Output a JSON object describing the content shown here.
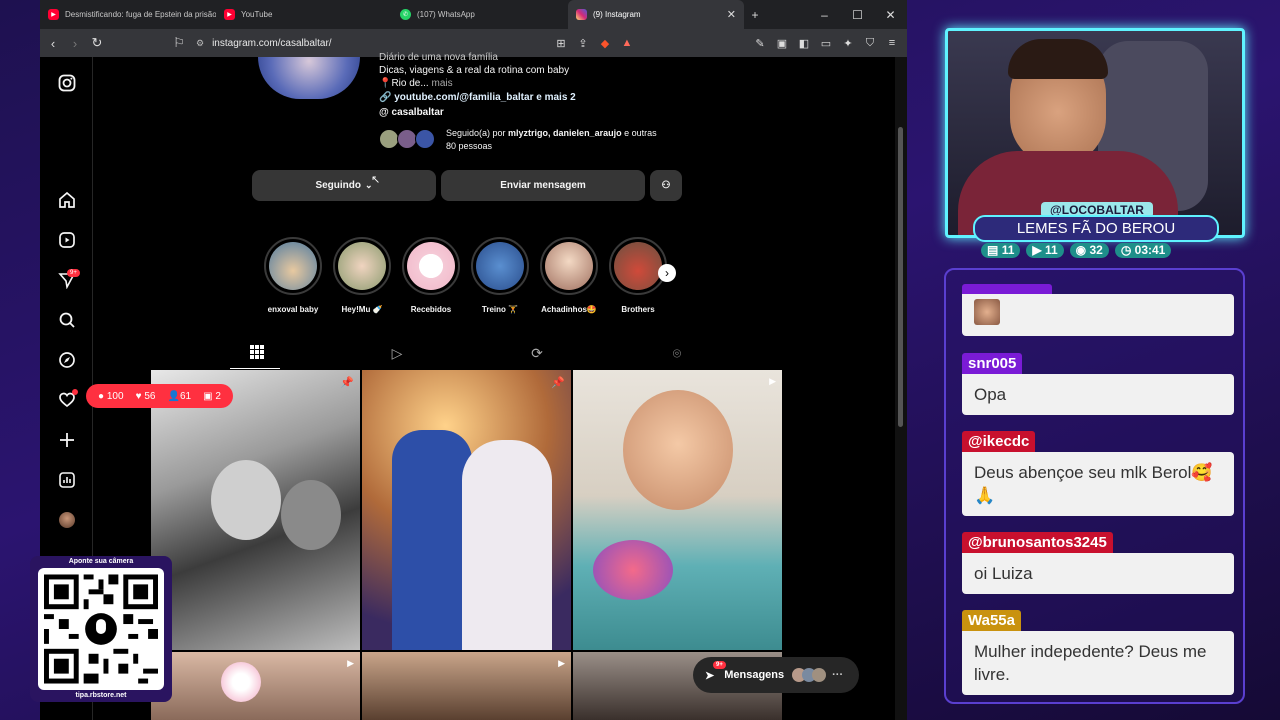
{
  "browser": {
    "tabs": [
      {
        "title": "Desmistificando: fuga de Epstein da prisão e",
        "icon": "youtube-icon",
        "color": "#ff0033"
      },
      {
        "title": "YouTube",
        "icon": "youtube-icon",
        "color": "#ff0033"
      },
      {
        "title": "(107) WhatsApp",
        "icon": "whatsapp-icon",
        "color": "#25d366"
      },
      {
        "title": "(9) Instagram",
        "icon": "instagram-icon",
        "color": "#e1306c"
      }
    ],
    "url": "instagram.com/casalbaltar/"
  },
  "sidebar": {
    "notifications_badge": "9+"
  },
  "profile": {
    "bio_line1": "Diário de uma nova família",
    "bio_line2": "Dicas, viagens & a real da rotina com baby",
    "bio_line3": "📍Rio de...",
    "bio_more": "mais",
    "link": "youtube.com/@familia_baltar e mais 2",
    "threads": "casalbaltar",
    "followed_prefix": "Seguido(a) por ",
    "followed_names": "mlyztrigo, danielen_araujo",
    "followed_suffix": " e outras",
    "followed_line2": "80 pessoas",
    "following_label": "Seguindo",
    "message_label": "Enviar mensagem"
  },
  "highlights": [
    {
      "label": "enxoval baby"
    },
    {
      "label": "Hey!Mu 🍼"
    },
    {
      "label": "Recebidos"
    },
    {
      "label": "Treino 🏋"
    },
    {
      "label": "Achadinhos🤩"
    },
    {
      "label": "Brothers"
    }
  ],
  "overlay_stats": {
    "comments": "100",
    "likes": "56",
    "followers": "61",
    "profiles": "2"
  },
  "messages_bar": {
    "label": "Mensagens",
    "badge": "9+"
  },
  "qr": {
    "title": "Aponte sua câmera",
    "url": "tipa.rbstore.net"
  },
  "streamer": {
    "handle": "@LOCOBALTAR",
    "title": "LEMES FÃ DO BEROU",
    "stats": [
      {
        "icon": "chat-icon",
        "value": "11"
      },
      {
        "icon": "youtube-icon",
        "value": "11"
      },
      {
        "icon": "viewers-icon",
        "value": "32"
      },
      {
        "icon": "clock-icon",
        "value": "03:41"
      }
    ]
  },
  "chat": [
    {
      "user": "",
      "text": ""
    },
    {
      "user": "snr005",
      "text": "Opa",
      "color": "#7a1bd6"
    },
    {
      "user": "@ikecdc",
      "text": "Deus abençoe seu mlk Berol🥰 🙏",
      "color": "#c8102e"
    },
    {
      "user": "@brunosantos3245",
      "text": "oi Luiza",
      "color": "#c8102e"
    },
    {
      "user": "Wa55a",
      "text": "Mulher indepedente? Deus me livre.",
      "color": "#c9920f"
    }
  ]
}
